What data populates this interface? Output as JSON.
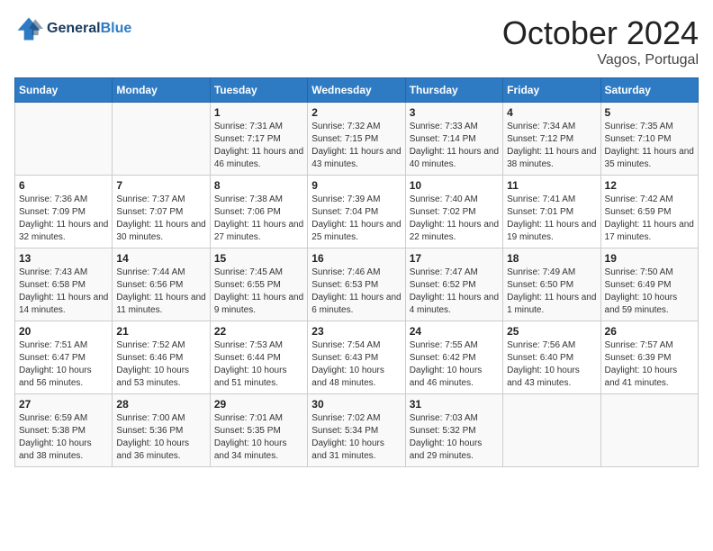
{
  "header": {
    "logo_line1": "General",
    "logo_line2": "Blue",
    "month": "October 2024",
    "location": "Vagos, Portugal"
  },
  "days_of_week": [
    "Sunday",
    "Monday",
    "Tuesday",
    "Wednesday",
    "Thursday",
    "Friday",
    "Saturday"
  ],
  "weeks": [
    [
      {
        "day": "",
        "info": ""
      },
      {
        "day": "",
        "info": ""
      },
      {
        "day": "1",
        "info": "Sunrise: 7:31 AM\nSunset: 7:17 PM\nDaylight: 11 hours and 46 minutes."
      },
      {
        "day": "2",
        "info": "Sunrise: 7:32 AM\nSunset: 7:15 PM\nDaylight: 11 hours and 43 minutes."
      },
      {
        "day": "3",
        "info": "Sunrise: 7:33 AM\nSunset: 7:14 PM\nDaylight: 11 hours and 40 minutes."
      },
      {
        "day": "4",
        "info": "Sunrise: 7:34 AM\nSunset: 7:12 PM\nDaylight: 11 hours and 38 minutes."
      },
      {
        "day": "5",
        "info": "Sunrise: 7:35 AM\nSunset: 7:10 PM\nDaylight: 11 hours and 35 minutes."
      }
    ],
    [
      {
        "day": "6",
        "info": "Sunrise: 7:36 AM\nSunset: 7:09 PM\nDaylight: 11 hours and 32 minutes."
      },
      {
        "day": "7",
        "info": "Sunrise: 7:37 AM\nSunset: 7:07 PM\nDaylight: 11 hours and 30 minutes."
      },
      {
        "day": "8",
        "info": "Sunrise: 7:38 AM\nSunset: 7:06 PM\nDaylight: 11 hours and 27 minutes."
      },
      {
        "day": "9",
        "info": "Sunrise: 7:39 AM\nSunset: 7:04 PM\nDaylight: 11 hours and 25 minutes."
      },
      {
        "day": "10",
        "info": "Sunrise: 7:40 AM\nSunset: 7:02 PM\nDaylight: 11 hours and 22 minutes."
      },
      {
        "day": "11",
        "info": "Sunrise: 7:41 AM\nSunset: 7:01 PM\nDaylight: 11 hours and 19 minutes."
      },
      {
        "day": "12",
        "info": "Sunrise: 7:42 AM\nSunset: 6:59 PM\nDaylight: 11 hours and 17 minutes."
      }
    ],
    [
      {
        "day": "13",
        "info": "Sunrise: 7:43 AM\nSunset: 6:58 PM\nDaylight: 11 hours and 14 minutes."
      },
      {
        "day": "14",
        "info": "Sunrise: 7:44 AM\nSunset: 6:56 PM\nDaylight: 11 hours and 11 minutes."
      },
      {
        "day": "15",
        "info": "Sunrise: 7:45 AM\nSunset: 6:55 PM\nDaylight: 11 hours and 9 minutes."
      },
      {
        "day": "16",
        "info": "Sunrise: 7:46 AM\nSunset: 6:53 PM\nDaylight: 11 hours and 6 minutes."
      },
      {
        "day": "17",
        "info": "Sunrise: 7:47 AM\nSunset: 6:52 PM\nDaylight: 11 hours and 4 minutes."
      },
      {
        "day": "18",
        "info": "Sunrise: 7:49 AM\nSunset: 6:50 PM\nDaylight: 11 hours and 1 minute."
      },
      {
        "day": "19",
        "info": "Sunrise: 7:50 AM\nSunset: 6:49 PM\nDaylight: 10 hours and 59 minutes."
      }
    ],
    [
      {
        "day": "20",
        "info": "Sunrise: 7:51 AM\nSunset: 6:47 PM\nDaylight: 10 hours and 56 minutes."
      },
      {
        "day": "21",
        "info": "Sunrise: 7:52 AM\nSunset: 6:46 PM\nDaylight: 10 hours and 53 minutes."
      },
      {
        "day": "22",
        "info": "Sunrise: 7:53 AM\nSunset: 6:44 PM\nDaylight: 10 hours and 51 minutes."
      },
      {
        "day": "23",
        "info": "Sunrise: 7:54 AM\nSunset: 6:43 PM\nDaylight: 10 hours and 48 minutes."
      },
      {
        "day": "24",
        "info": "Sunrise: 7:55 AM\nSunset: 6:42 PM\nDaylight: 10 hours and 46 minutes."
      },
      {
        "day": "25",
        "info": "Sunrise: 7:56 AM\nSunset: 6:40 PM\nDaylight: 10 hours and 43 minutes."
      },
      {
        "day": "26",
        "info": "Sunrise: 7:57 AM\nSunset: 6:39 PM\nDaylight: 10 hours and 41 minutes."
      }
    ],
    [
      {
        "day": "27",
        "info": "Sunrise: 6:59 AM\nSunset: 5:38 PM\nDaylight: 10 hours and 38 minutes."
      },
      {
        "day": "28",
        "info": "Sunrise: 7:00 AM\nSunset: 5:36 PM\nDaylight: 10 hours and 36 minutes."
      },
      {
        "day": "29",
        "info": "Sunrise: 7:01 AM\nSunset: 5:35 PM\nDaylight: 10 hours and 34 minutes."
      },
      {
        "day": "30",
        "info": "Sunrise: 7:02 AM\nSunset: 5:34 PM\nDaylight: 10 hours and 31 minutes."
      },
      {
        "day": "31",
        "info": "Sunrise: 7:03 AM\nSunset: 5:32 PM\nDaylight: 10 hours and 29 minutes."
      },
      {
        "day": "",
        "info": ""
      },
      {
        "day": "",
        "info": ""
      }
    ]
  ]
}
